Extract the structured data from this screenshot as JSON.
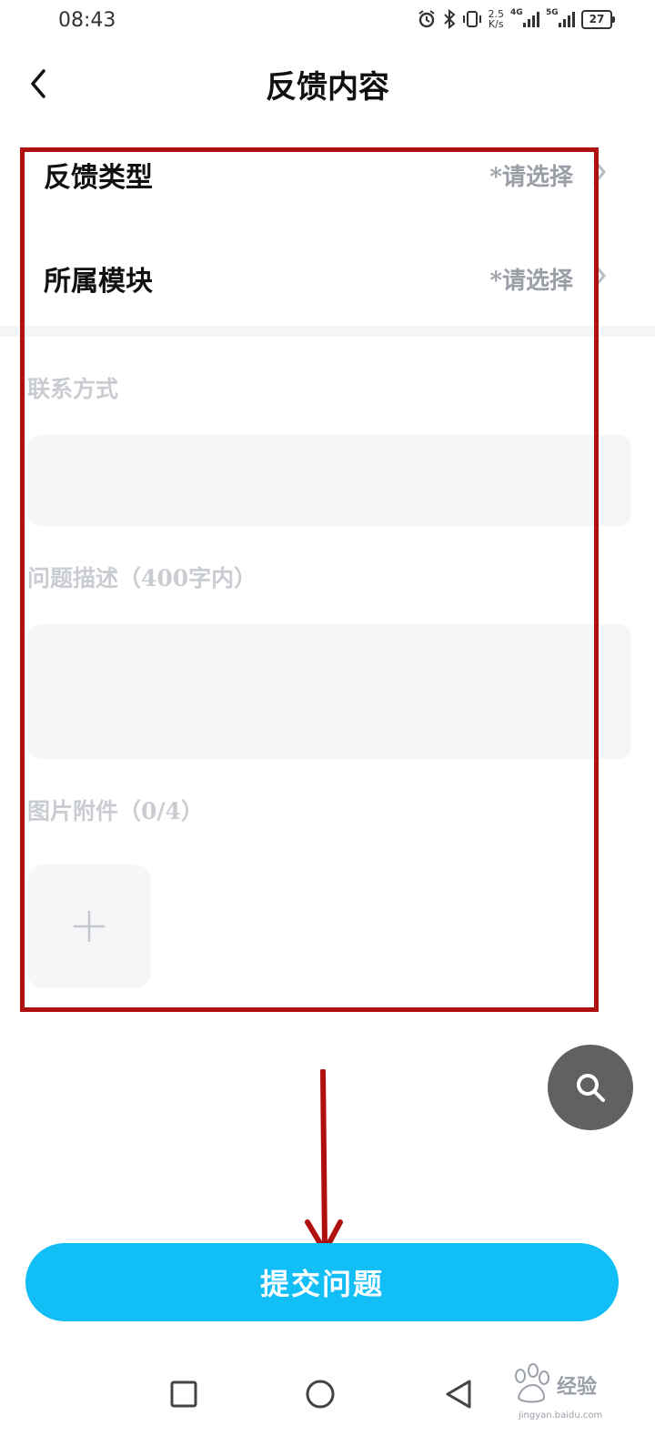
{
  "status_bar": {
    "time": "08:43",
    "net_speed_value": "2.5",
    "net_speed_unit": "K/s",
    "signal_1_gen": "4G",
    "signal_2_gen": "5G",
    "battery": "27"
  },
  "header": {
    "title": "反馈内容",
    "back_icon": "chevron-left-icon"
  },
  "form": {
    "feedback_type": {
      "label": "反馈类型",
      "value": "*请选择"
    },
    "module": {
      "label": "所属模块",
      "value": "*请选择"
    },
    "contact": {
      "label": "联系方式",
      "value": ""
    },
    "description": {
      "label": "问题描述（400字内）",
      "value": ""
    },
    "attachments": {
      "label": "图片附件（0/4）",
      "add_icon": "plus-icon"
    }
  },
  "fab": {
    "icon": "search-icon"
  },
  "submit_label": "提交问题",
  "watermark": {
    "brand": "Baidu",
    "text": "经验",
    "url": "jingyan.baidu.com"
  },
  "colors": {
    "accent": "#12bef6",
    "annotation": "#b01010",
    "placeholder": "#9a9ea6",
    "fab": "#616161"
  }
}
